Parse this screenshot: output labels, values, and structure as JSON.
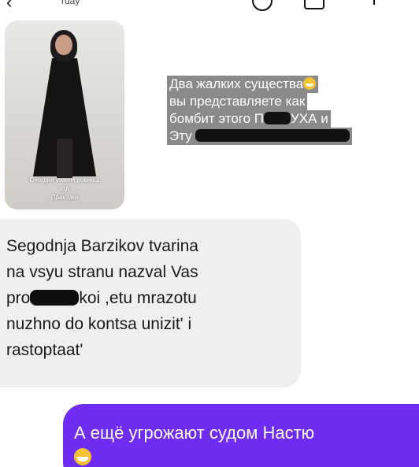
{
  "header": {
    "contact_name": "ruay"
  },
  "story_reply": {
    "caption_line1": "Сегодня у меня ровно 1",
    "caption_line2": "год",
    "caption_line3": "Практики"
  },
  "quoted_text": {
    "line1": "Два жалких существа",
    "line2": "вы представляете как",
    "line3a": "бомбит этого П",
    "line3b": "УХА и",
    "line4": "Эту"
  },
  "incoming_message": {
    "line1": "Segodnja Barzikov tvarina",
    "line2": "na vsyu stranu nazval Vas",
    "line3a": "pro",
    "line3b": "koi ,etu mrazotu",
    "line4": "nuzhno do kontsa unizit' i",
    "line5": "rastoptaat'"
  },
  "outgoing_message": {
    "text": "А ещё угрожают судом Настю"
  },
  "icons": {
    "emoji": "grinning-face-icon"
  },
  "colors": {
    "outgoing_bubble": "#6f2cf3",
    "incoming_bubble": "#efefef",
    "quote_highlight": "#8a8a8a"
  }
}
